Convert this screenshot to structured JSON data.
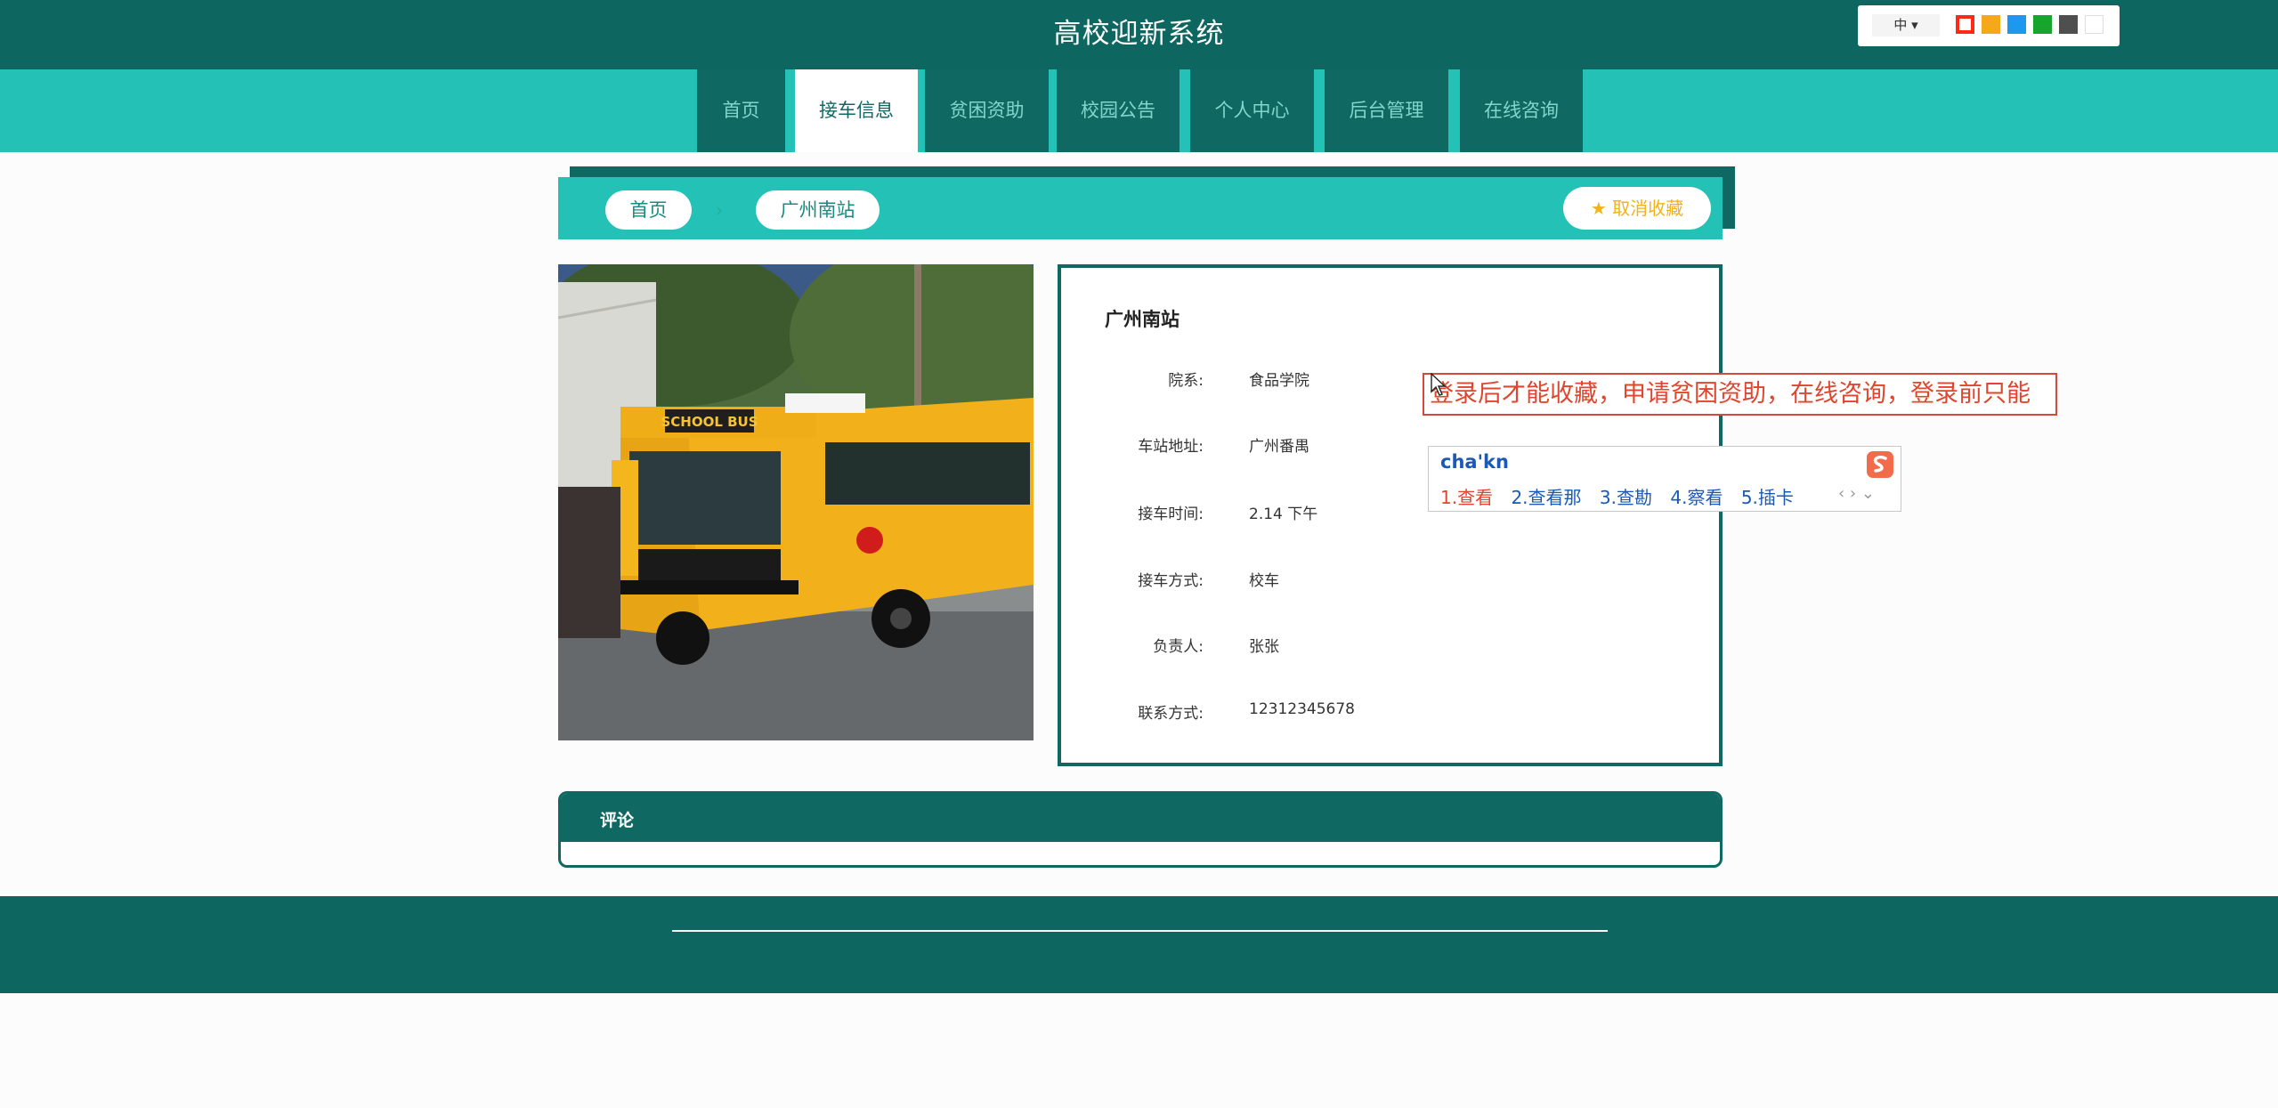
{
  "header": {
    "title": "高校迎新系统",
    "lang_label": "中 ▾",
    "theme_colors": [
      "#ff2a16",
      "#f5a91a",
      "#1d98ef",
      "#17a52d",
      "#4f4f4f",
      "#ffffff"
    ]
  },
  "nav": {
    "items": [
      {
        "label": "首页"
      },
      {
        "label": "接车信息"
      },
      {
        "label": "贫困资助"
      },
      {
        "label": "校园公告"
      },
      {
        "label": "个人中心"
      },
      {
        "label": "后台管理"
      },
      {
        "label": "在线咨询"
      }
    ],
    "active": "接车信息"
  },
  "breadcrumb": {
    "home": "首页",
    "current": "广州南站",
    "separator": "›",
    "favorite_label": "★ 取消收藏"
  },
  "detail": {
    "title": "广州南站",
    "rows": [
      {
        "label": "院系:",
        "value": "食品学院"
      },
      {
        "label": "车站地址:",
        "value": "广州番禺"
      },
      {
        "label": "接车时间:",
        "value": "2.14 下午"
      },
      {
        "label": "接车方式:",
        "value": "校车"
      },
      {
        "label": "负责人:",
        "value": "张张"
      },
      {
        "label": "联系方式:",
        "value": "12312345678"
      }
    ]
  },
  "bus_sign": "SCHOOL BUS",
  "comment": {
    "title": "评论"
  },
  "tooltip": {
    "text": "登录后才能收藏，申请贫困资助，在线咨询，登录前只能"
  },
  "ime": {
    "input": "cha'kn",
    "candidates": [
      "1.查看",
      "2.查看那",
      "3.查勘",
      "4.察看",
      "5.插卡"
    ],
    "arrows": "‹ › ⌄"
  }
}
